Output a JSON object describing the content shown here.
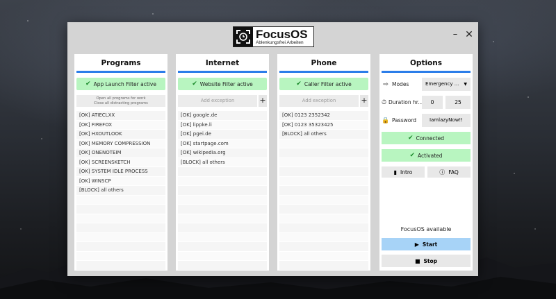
{
  "window": {
    "app_name": "FocusOS",
    "app_subtitle": "Ablenkungsfrei Arbeiten",
    "minimize_icon": "minimize-icon",
    "close_icon": "close-icon"
  },
  "programs": {
    "title": "Programs",
    "filter_label": "App Launch Filter active",
    "open_all_label": "Open all programs for work",
    "close_all_label": "Close all distracting programs",
    "items": [
      "[OK] ATIECLXX",
      "[OK] FIREFOX",
      "[OK] HXOUTLOOK",
      "[OK] MEMORY COMPRESSION",
      "[OK] ONENOTEIM",
      "[OK] SCREENSKETCH",
      "[OK] SYSTEM IDLE PROCESS",
      "[OK] WINSCP",
      "[BLOCK] all others"
    ]
  },
  "internet": {
    "title": "Internet",
    "filter_label": "Website Filter active",
    "exception_placeholder": "Add exception",
    "add_label": "+",
    "items": [
      "[OK] google.de",
      "[OK] lippke.li",
      "[OK] pgei.de",
      "[OK] startpage.com",
      "[OK] wikipedia.org",
      "[BLOCK] all others"
    ]
  },
  "phone": {
    "title": "Phone",
    "filter_label": "Caller Filter active",
    "exception_placeholder": "Add exception",
    "add_label": "+",
    "items": [
      "[OK] 0123 2352342",
      "[OK] 0123 35323425",
      "[BLOCK] all others"
    ]
  },
  "options": {
    "title": "Options",
    "modes_label": "Modes",
    "modes_value": "Emergency ...",
    "duration_label": "Duration hr...",
    "duration_hours": "0",
    "duration_minutes": "25",
    "password_label": "Password",
    "password_value": "IamlazyNow!!",
    "connected_label": "Connected",
    "activated_label": "Activated",
    "intro_label": "Intro",
    "faq_label": "FAQ",
    "status_text": "FocusOS available",
    "start_label": "Start",
    "stop_label": "Stop"
  },
  "colors": {
    "accent_blue": "#2b7de9",
    "active_green": "#b8f5c0",
    "start_blue": "#a7d3f7"
  }
}
